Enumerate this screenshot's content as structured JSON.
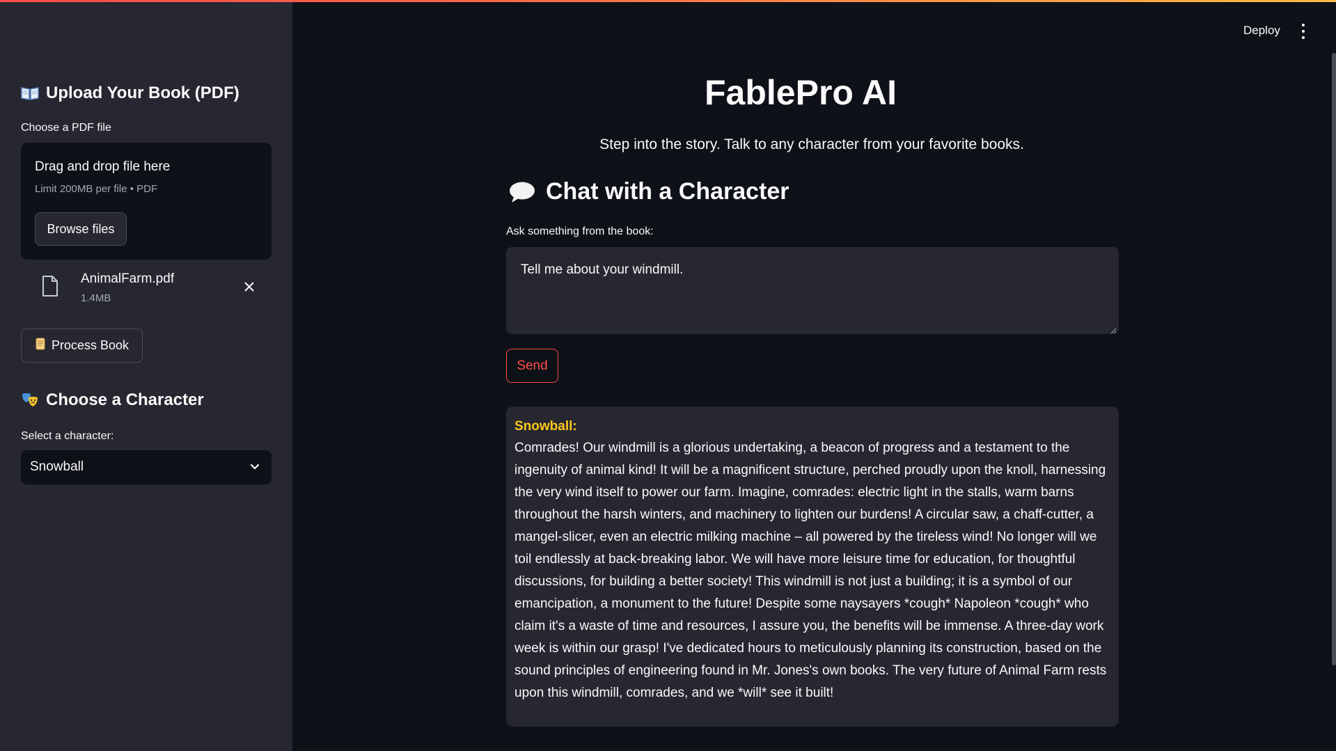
{
  "sidebar": {
    "upload_title": "Upload Your Book (PDF)",
    "upload_icon": "open-book-icon",
    "file_label": "Choose a PDF file",
    "dropzone_title": "Drag and drop file here",
    "dropzone_limit": "Limit 200MB per file • PDF",
    "browse_label": "Browse files",
    "file": {
      "name": "AnimalFarm.pdf",
      "size": "1.4MB"
    },
    "process_label": "Process Book",
    "character_title": "Choose a Character",
    "character_icon": "theater-masks-icon",
    "select_label": "Select a character:",
    "selected_character": "Snowball"
  },
  "header": {
    "deploy_label": "Deploy"
  },
  "main": {
    "title": "FablePro AI",
    "subtitle": "Step into the story. Talk to any character from your favorite books.",
    "chat_heading": "Chat with a Character",
    "ask_label": "Ask something from the book:",
    "question": "Tell me about your windmill.",
    "send_label": "Send",
    "response": {
      "speaker": "Snowball:",
      "text": "Comrades! Our windmill is a glorious undertaking, a beacon of progress and a testament to the ingenuity of animal kind!  It will be a magnificent structure, perched proudly upon the knoll, harnessing the very wind itself to power our farm. Imagine, comrades: electric light in the stalls, warm barns throughout the harsh winters, and machinery to lighten our burdens! A circular saw, a chaff-cutter, a mangel-slicer, even an electric milking machine – all powered by the tireless wind! No longer will we toil endlessly at back-breaking labor. We will have more leisure time for education, for thoughtful discussions, for building a better society!  This windmill is not just a building; it is a symbol of our emancipation, a monument to the future!  Despite some naysayers *cough* Napoleon *cough* who claim it's a waste of time and resources, I assure you, the benefits will be immense. A three-day work week is within our grasp!  I've dedicated hours to meticulously planning its construction, based on the sound principles of engineering found in Mr. Jones's own books.  The very future of Animal Farm rests upon this windmill, comrades, and we *will* see it built!"
    }
  },
  "colors": {
    "background": "#0e1117",
    "sidebar": "#262730",
    "accent": "#ff4b4b",
    "speaker": "#ffc71a"
  }
}
